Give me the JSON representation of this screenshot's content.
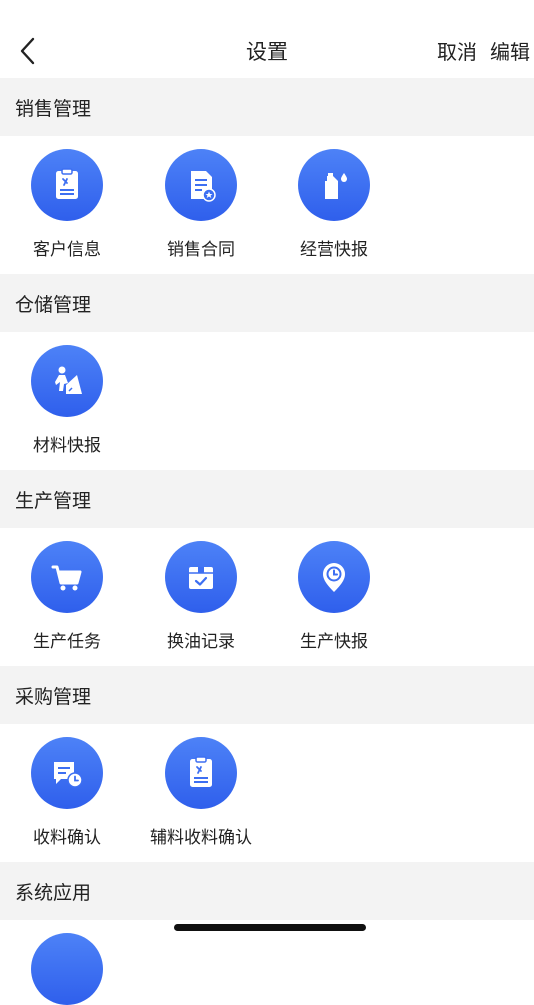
{
  "header": {
    "title": "设置",
    "cancel_label": "取消",
    "edit_label": "编辑"
  },
  "sections": [
    {
      "title": "销售管理",
      "items": [
        {
          "label": "客户信息",
          "icon": "clipboard-icon"
        },
        {
          "label": "销售合同",
          "icon": "contract-document-icon"
        },
        {
          "label": "经营快报",
          "icon": "oil-can-icon"
        }
      ]
    },
    {
      "title": "仓储管理",
      "items": [
        {
          "label": "材料快报",
          "icon": "worker-shovel-icon"
        }
      ]
    },
    {
      "title": "生产管理",
      "items": [
        {
          "label": "生产任务",
          "icon": "cart-icon"
        },
        {
          "label": "换油记录",
          "icon": "box-check-icon"
        },
        {
          "label": "生产快报",
          "icon": "location-clock-icon"
        }
      ]
    },
    {
      "title": "采购管理",
      "items": [
        {
          "label": "收料确认",
          "icon": "receipt-clock-icon"
        },
        {
          "label": "辅料收料确认",
          "icon": "clipboard-icon"
        }
      ]
    },
    {
      "title": "系统应用",
      "items": []
    }
  ]
}
